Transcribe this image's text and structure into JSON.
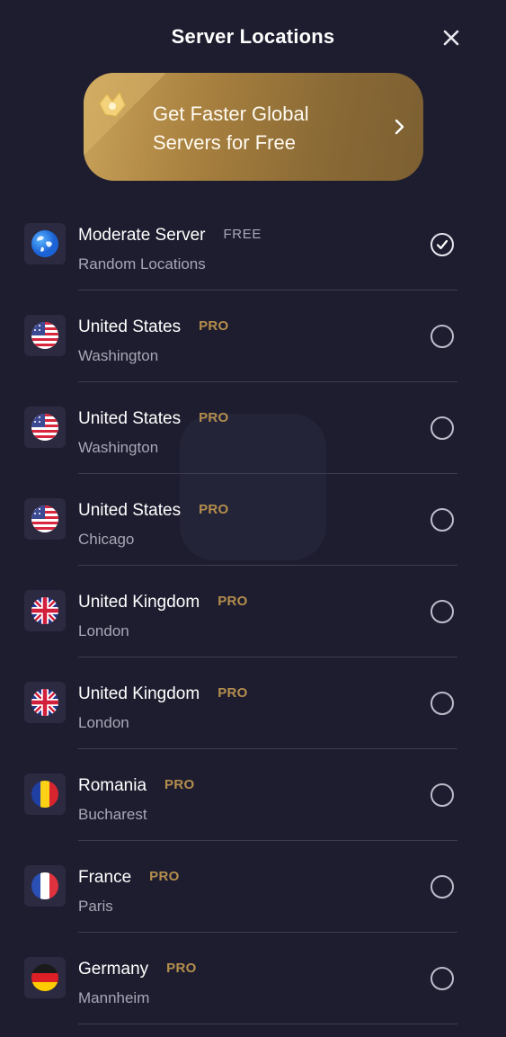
{
  "header": {
    "title": "Server Locations"
  },
  "banner": {
    "line1": "Get Faster Global",
    "line2": "Servers for Free"
  },
  "servers": [
    {
      "name": "Moderate Server",
      "badge": "FREE",
      "city": "Random Locations",
      "flag": "globe",
      "selected": true
    },
    {
      "name": "United States",
      "badge": "PRO",
      "city": "Washington",
      "flag": "us",
      "selected": false
    },
    {
      "name": "United States",
      "badge": "PRO",
      "city": "Washington",
      "flag": "us",
      "selected": false
    },
    {
      "name": "United States",
      "badge": "PRO",
      "city": "Chicago",
      "flag": "us",
      "selected": false
    },
    {
      "name": "United Kingdom",
      "badge": "PRO",
      "city": "London",
      "flag": "uk",
      "selected": false
    },
    {
      "name": "United Kingdom",
      "badge": "PRO",
      "city": "London",
      "flag": "uk",
      "selected": false
    },
    {
      "name": "Romania",
      "badge": "PRO",
      "city": "Bucharest",
      "flag": "ro",
      "selected": false
    },
    {
      "name": "France",
      "badge": "PRO",
      "city": "Paris",
      "flag": "fr",
      "selected": false
    },
    {
      "name": "Germany",
      "badge": "PRO",
      "city": "Mannheim",
      "flag": "de",
      "selected": false
    }
  ],
  "colors": {
    "background": "#1e1d2f",
    "pro_badge": "#b48e4d",
    "banner_gold": "#b08a48"
  }
}
